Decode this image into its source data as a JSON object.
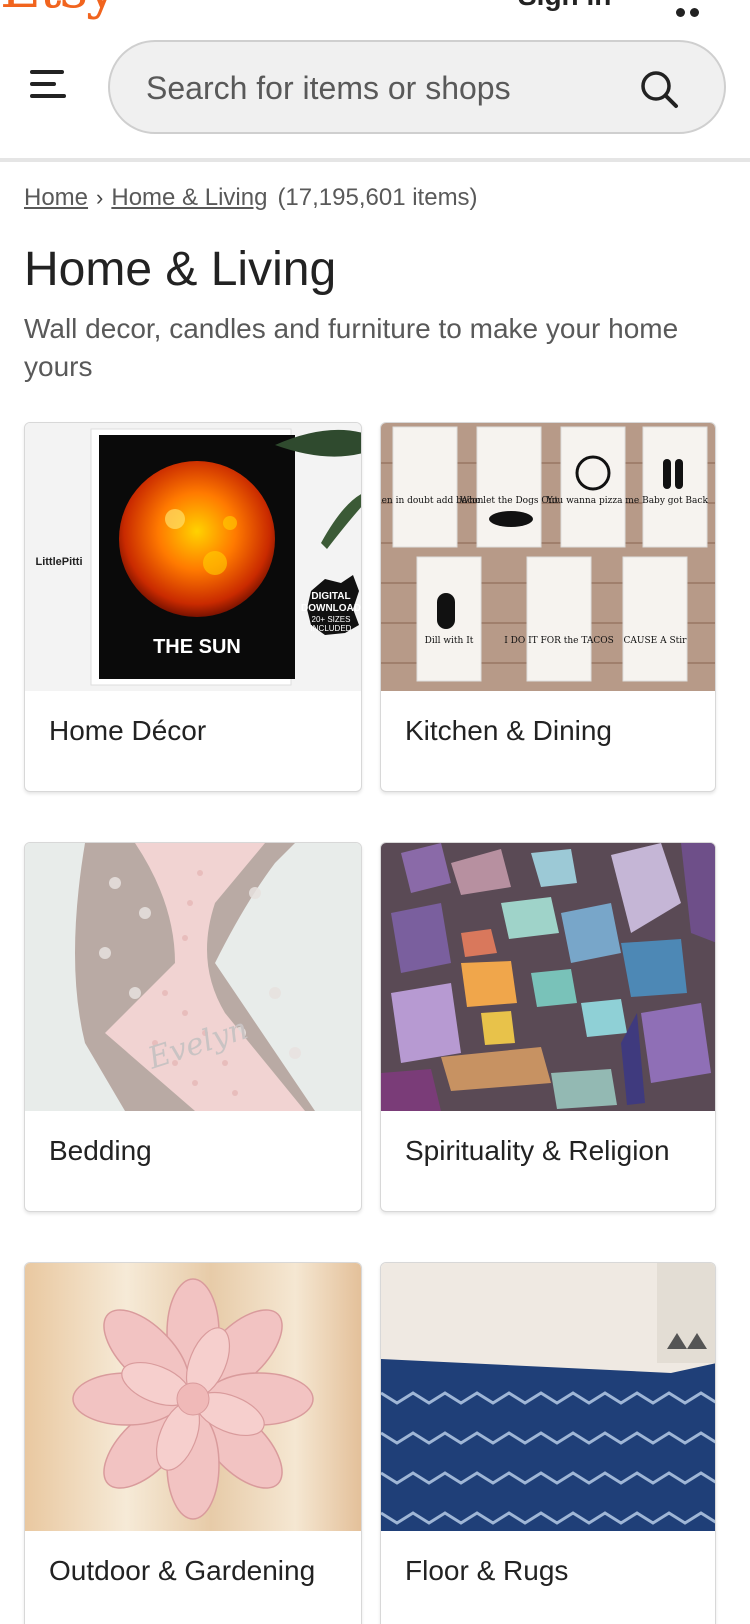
{
  "app": {
    "logo_text": "Etsy",
    "sign_in_label": "Sign in"
  },
  "search": {
    "placeholder": "Search for items or shops"
  },
  "breadcrumb": {
    "items": [
      "Home",
      "Home & Living"
    ],
    "count": "(17,195,601 items)"
  },
  "page": {
    "title": "Home & Living",
    "subtitle": "Wall decor, candles and furniture to make your home yours"
  },
  "categories": [
    {
      "label": "Home Décor",
      "image_text": {
        "brand": "LittlePitti",
        "caption": "THE SUN",
        "badge": [
          "DIGITAL",
          "DOWNLOAD",
          "20+ SIZES",
          "INCLUDED"
        ]
      }
    },
    {
      "label": "Kitchen & Dining",
      "image_text": {
        "towels": [
          "When in doubt add bacon",
          "Who let the Dogs Out",
          "You wanna pizza me",
          "Baby got Back",
          "Dill with It",
          "I DO IT FOR the TACOS",
          "CAUSE A Stir"
        ]
      }
    },
    {
      "label": "Bedding",
      "image_text": {
        "embroidery": "Evelyn"
      }
    },
    {
      "label": "Spirituality & Religion"
    },
    {
      "label": "Outdoor & Gardening"
    },
    {
      "label": "Floor & Rugs"
    }
  ],
  "colors": {
    "brand": "#F1641E",
    "text": "#222222",
    "muted": "#595959",
    "search_bg": "#f0f0f0"
  }
}
